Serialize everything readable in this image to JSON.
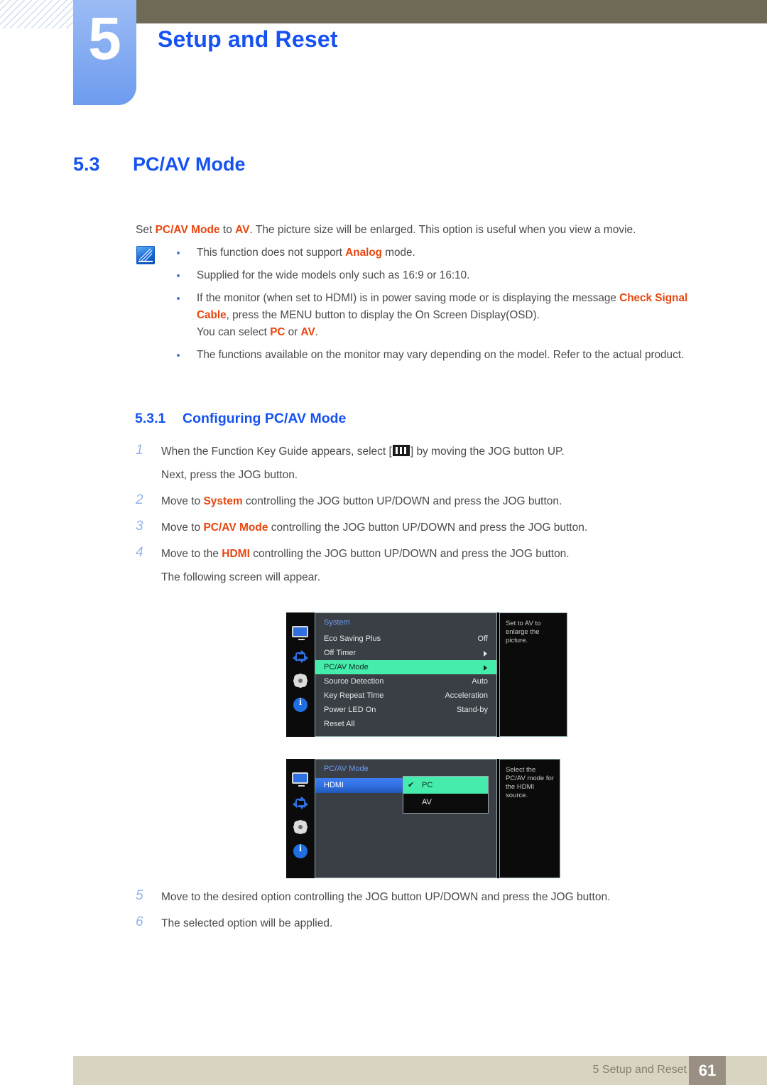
{
  "header": {
    "chapter_number": "5",
    "chapter_title": "Setup and Reset"
  },
  "section": {
    "number": "5.3",
    "title": "PC/AV Mode",
    "intro_prefix": "Set ",
    "intro_term1": "PC/AV Mode",
    "intro_mid": " to ",
    "intro_term2": "AV",
    "intro_suffix": ". The picture size will be enlarged. This option is useful when you view a movie."
  },
  "notes": {
    "icon": "note-pen-icon",
    "items": [
      {
        "parts": [
          {
            "t": "This function does not support ",
            "hl": false
          },
          {
            "t": "Analog",
            "hl": true
          },
          {
            "t": " mode.",
            "hl": false
          }
        ]
      },
      {
        "parts": [
          {
            "t": "Supplied for the wide models only such as 16:9 or 16:10.",
            "hl": false
          }
        ]
      },
      {
        "parts": [
          {
            "t": "If the monitor (when set to HDMI) is in power saving mode or is displaying the message ",
            "hl": false
          },
          {
            "t": "Check Signal Cable",
            "hl": true
          },
          {
            "t": ", press the MENU button to display the On Screen Display(OSD).",
            "hl": false
          },
          {
            "t": "BREAK",
            "hl": false
          },
          {
            "t": "You can select ",
            "hl": false
          },
          {
            "t": "PC",
            "hl": true
          },
          {
            "t": " or ",
            "hl": false
          },
          {
            "t": "AV",
            "hl": true
          },
          {
            "t": ".",
            "hl": false
          }
        ]
      },
      {
        "parts": [
          {
            "t": "The functions available on the monitor may vary depending on the model. Refer to the actual product.",
            "hl": false
          }
        ]
      }
    ]
  },
  "subsection": {
    "number": "5.3.1",
    "title": "Configuring PC/AV Mode"
  },
  "steps_top": [
    {
      "num": "1",
      "pre": "When the Function Key Guide appears, select [",
      "glyph": "function-key-guide-icon",
      "post": "] by moving the JOG button UP.",
      "cont": "Next, press the JOG button."
    },
    {
      "num": "2",
      "pre": "Move to ",
      "term": "System",
      "post": " controlling the JOG button UP/DOWN and press the JOG button."
    },
    {
      "num": "3",
      "pre": "Move to ",
      "term": "PC/AV Mode",
      "post": " controlling the JOG button UP/DOWN and press the JOG button."
    },
    {
      "num": "4",
      "pre": "Move to the ",
      "term": "HDMI",
      "post": " controlling the JOG button UP/DOWN and press the JOG button.",
      "cont": "The following screen will appear."
    }
  ],
  "steps_bottom": [
    {
      "num": "5",
      "pre": "Move to the desired option controlling the JOG button UP/DOWN and press the JOG button."
    },
    {
      "num": "6",
      "pre": "The selected option will be applied."
    }
  ],
  "osd_system": {
    "title": "System",
    "rail_icons": [
      "monitor-icon",
      "move-arrows-icon",
      "gear-icon",
      "info-icon"
    ],
    "rows": [
      {
        "label": "Eco Saving Plus",
        "value": "Off",
        "arrow": false,
        "selected": false
      },
      {
        "label": "Off Timer",
        "value": "",
        "arrow": true,
        "selected": false
      },
      {
        "label": "PC/AV Mode",
        "value": "",
        "arrow": true,
        "selected": true
      },
      {
        "label": "Source Detection",
        "value": "Auto",
        "arrow": false,
        "selected": false
      },
      {
        "label": "Key Repeat Time",
        "value": "Acceleration",
        "arrow": false,
        "selected": false
      },
      {
        "label": "Power LED On",
        "value": "Stand-by",
        "arrow": false,
        "selected": false
      },
      {
        "label": "Reset All",
        "value": "",
        "arrow": false,
        "selected": false
      }
    ],
    "tooltip": "Set to AV to enlarge the picture."
  },
  "osd_pcav": {
    "title": "PC/AV Mode",
    "rail_icons": [
      "monitor-icon",
      "move-arrows-icon",
      "gear-icon",
      "info-icon"
    ],
    "source_row": "HDMI",
    "options": [
      {
        "name": "PC",
        "checked": true,
        "check_glyph": "✔"
      },
      {
        "name": "AV",
        "checked": false,
        "check_glyph": ""
      }
    ],
    "tooltip": "Select the PC/AV mode for the HDMI source."
  },
  "footer": {
    "label": "5 Setup and Reset",
    "page_number": "61"
  },
  "colors": {
    "accent_blue": "#1552f0",
    "highlight_orange": "#e8460f",
    "badge_blue": "#87aef2",
    "olive": "#6e6a56",
    "footer_beige": "#d9d4c2",
    "footer_pagebox": "#9a8f83",
    "osd_select_green": "#45ecac",
    "osd_panel": "#3a3f45"
  }
}
